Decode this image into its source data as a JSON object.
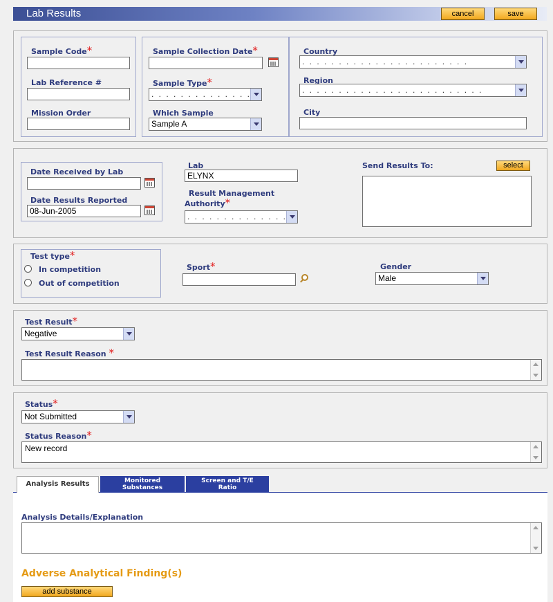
{
  "window": {
    "title": "Lab Results"
  },
  "toolbar": {
    "cancel_label": "cancel",
    "save_label": "save"
  },
  "sample": {
    "sample_code_label": "Sample Code",
    "sample_code_value": "",
    "lab_reference_label": "Lab Reference #",
    "lab_reference_value": "",
    "mission_order_label": "Mission Order",
    "mission_order_value": "",
    "collection_date_label": "Sample Collection Date",
    "collection_date_value": "",
    "sample_type_label": "Sample Type",
    "sample_type_value": ". . . . . . . . . . . . . . .",
    "which_sample_label": "Which Sample",
    "which_sample_value": "Sample A",
    "country_label": "Country",
    "country_value": ". . . . . . . . . . . . . . . . . . . . . . .",
    "region_label": "Region",
    "region_value": ". .   . . . . . . . . . . . . . . . . . . . . . . .",
    "city_label": "City",
    "city_value": ""
  },
  "lab": {
    "date_received_label": "Date Received by Lab",
    "date_received_value": "",
    "date_reported_label": "Date Results Reported",
    "date_reported_value": "08-Jun-2005",
    "lab_label": "Lab",
    "lab_value": "ELYNX",
    "rma_label_line1": "Result Management",
    "rma_label_line2": "Authority",
    "rma_value": ". . . . . . . . . . . . . . .",
    "send_results_label": "Send Results To:",
    "select_label": "select",
    "send_results_value": ""
  },
  "test": {
    "test_type_label": "Test type",
    "in_competition_label": "In competition",
    "out_of_competition_label": "Out of competition",
    "sport_label": "Sport",
    "sport_value": "",
    "gender_label": "Gender",
    "gender_value": "Male"
  },
  "result": {
    "test_result_label": "Test Result",
    "test_result_value": "Negative",
    "reason_label": "Test Result Reason",
    "reason_value": ""
  },
  "status": {
    "status_label": "Status",
    "status_value": "Not Submitted",
    "reason_label": "Status Reason",
    "reason_value": "New record"
  },
  "tabs": [
    {
      "label": "Analysis Results"
    },
    {
      "label_line1": "Monitored",
      "label_line2": "Substances"
    },
    {
      "label_line1": "Screen and T/E",
      "label_line2": "Ratio"
    }
  ],
  "analysis": {
    "details_label": "Analysis Details/Explanation",
    "details_value": "",
    "aaf_heading": "Adverse Analytical Finding(s)",
    "add_substance_label": "add substance"
  },
  "colors": {
    "accent_orange": "#e59b16",
    "label_blue": "#2e3b7d",
    "required_red": "#e21c1c",
    "tab_blue": "#2b3fa0"
  }
}
